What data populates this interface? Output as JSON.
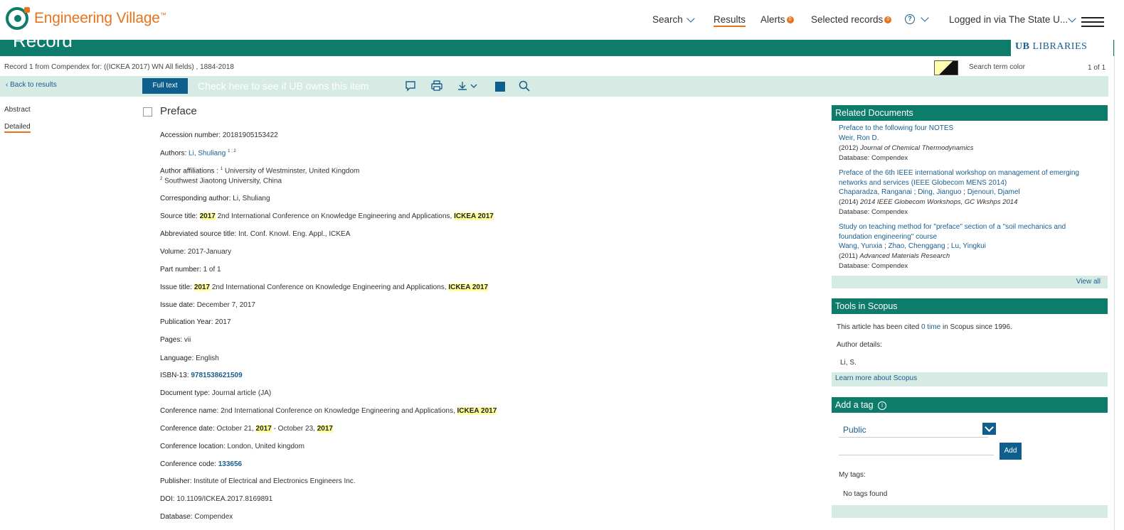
{
  "header": {
    "logo_text": "Engineering Village",
    "logo_tm": "™",
    "nav": {
      "search": "Search",
      "results": "Results",
      "alerts": "Alerts",
      "alerts_count": "0",
      "selected": "Selected records",
      "selected_count": "0",
      "help": "?",
      "logged": "Logged in via The State U..."
    }
  },
  "band": {
    "title": "Record",
    "library": "LIBRARIES",
    "library_mark": "UB"
  },
  "record_bar": {
    "record_line": "Record 1 from Compendex for: ((ICKEA 2017) WN All fields) , 1884-2018",
    "search_term_color": "Search term color",
    "pager": "1 of 1"
  },
  "toolbar": {
    "back": "Back to results",
    "full_text": "Full text",
    "ub_owns": "Check here to see if UB owns this item"
  },
  "sidebar": {
    "abstract": "Abstract",
    "detailed": "Detailed"
  },
  "record": {
    "title": "Preface",
    "accession_label": "Accession number:",
    "accession": "20181905153422",
    "authors_label": "Authors:",
    "author_last": "Li,",
    "author_first": "Shuliang",
    "author_sup": "1 ; 2",
    "affil_label": "Author affiliations :",
    "affil1_sup": "1",
    "affil1": "University of Westminster, United Kingdom",
    "affil2_sup": "2",
    "affil2": "Southwest Jiaotong University, China",
    "corr_label": "Corresponding author:",
    "corr": "Li, Shuliang",
    "source_label": "Source title:",
    "year_hl": "2017",
    "conf_name_text": "2nd International Conference on Knowledge Engineering and Applications,",
    "ickea_hl": "ICKEA 2017",
    "abbr_label": "Abbreviated source title:",
    "abbr": "Int. Conf. Knowl. Eng. Appl., ICKEA",
    "volume_label": "Volume:",
    "volume": "2017-January",
    "part_label": "Part number:",
    "part": "1 of 1",
    "issue_title_label": "Issue title:",
    "issue_date_label": "Issue date:",
    "issue_date": "December 7, 2017",
    "pubyear_label": "Publication Year:",
    "pubyear": "2017",
    "pages_label": "Pages:",
    "pages": "vii",
    "language_label": "Language:",
    "language": "English",
    "isbn_label": "ISBN-13:",
    "isbn": "9781538621509",
    "doctype_label": "Document type:",
    "doctype": "Journal article (JA)",
    "confname_label": "Conference name:",
    "confdate_label": "Conference date:",
    "confdate_start": "October 21,",
    "confdate_mid": "- October 23,",
    "confloc_label": "Conference location:",
    "confloc": "London, United kingdom",
    "confcode_label": "Conference code:",
    "confcode": "133656",
    "publisher_label": "Publisher:",
    "publisher": "Institute of Electrical and Electronics Engineers Inc.",
    "doi_label": "DOI:",
    "doi": "10.1109/ICKEA.2017.8169891",
    "database_label": "Database:",
    "database": "Compendex"
  },
  "related": {
    "heading": "Related Documents",
    "items": [
      {
        "title": "Preface to the following four NOTES",
        "authors": [
          "Weir, Ron D."
        ],
        "year": "(2012)",
        "source": "Journal of Chemical Thermodynamics",
        "database": "Database: Compendex"
      },
      {
        "title_line1": "Preface of the 6th IEEE international workshop on management of emerging",
        "title_line2": "networks and services (IEEE Globecom MENS 2014)",
        "authors": [
          "Chaparadza, Ranganai",
          "Ding, Jianguo",
          "Djenouri, Djamel"
        ],
        "year": "(2014)",
        "source": "2014 IEEE Globecom Workshops, GC Wkshps 2014",
        "database": "Database: Compendex"
      },
      {
        "title_line1": "Study on teaching method for \"preface\" section of a \"soil mechanics and",
        "title_line2": "foundation engineering\" course",
        "authors": [
          "Wang, Yunxia",
          "Zhao, Chenggang",
          "Lu, Yingkui"
        ],
        "year": "(2011)",
        "source": "Advanced Materials Research",
        "database": "Database: Compendex"
      }
    ],
    "separator": ";",
    "view_all": "View all"
  },
  "scopus": {
    "heading": "Tools in Scopus",
    "cited_pre": "This article has been cited",
    "cited_link": "0 time",
    "cited_post": "in Scopus since 1996.",
    "author_details": "Author details:",
    "author": "Li, S.",
    "learn_more": "Learn more about Scopus"
  },
  "tag": {
    "heading": "Add a tag",
    "info": "i",
    "select_value": "Public",
    "add": "Add",
    "my_tags": "My tags:",
    "no_tags": "No tags found"
  },
  "colors": {
    "brand_green": "#0e7c6b",
    "brand_orange": "#e8731c",
    "link_blue": "#1a5e8e",
    "highlight": "#ffff9e"
  }
}
